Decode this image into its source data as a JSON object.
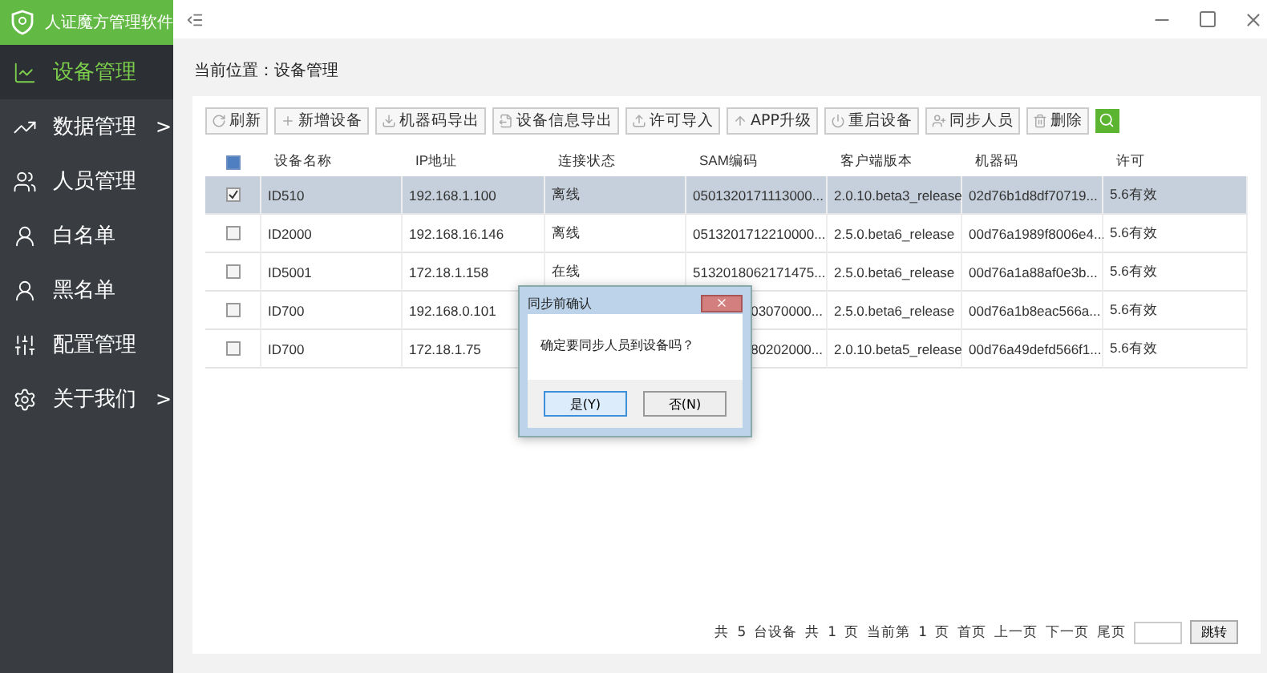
{
  "app": {
    "title": "人证魔方管理软件"
  },
  "sidebar": {
    "items": [
      {
        "label": "设备管理",
        "selected": true
      },
      {
        "label": "数据管理",
        "selected": false,
        "arrow": ">"
      },
      {
        "label": "人员管理",
        "selected": false
      },
      {
        "label": "白名单",
        "selected": false
      },
      {
        "label": "黑名单",
        "selected": false
      },
      {
        "label": "配置管理",
        "selected": false
      },
      {
        "label": "关于我们",
        "selected": false,
        "arrow": ">"
      }
    ]
  },
  "breadcrumb": "当前位置：设备管理",
  "toolbar": {
    "buttons": [
      "刷新",
      "新增设备",
      "机器码导出",
      "设备信息导出",
      "许可导入",
      "APP升级",
      "重启设备",
      "同步人员",
      "删除"
    ]
  },
  "table": {
    "columns": [
      "设备名称",
      "IP地址",
      "连接状态",
      "SAM编码",
      "客户端版本",
      "机器码",
      "许可"
    ],
    "all_checked": false,
    "rows": [
      {
        "selected": true,
        "checked": true,
        "cells": [
          "ID510",
          "192.168.1.100",
          "离线",
          "0501320171113000...",
          "2.0.10.beta3_release",
          "02d76b1d8df70719...",
          "5.6有效"
        ]
      },
      {
        "selected": false,
        "checked": false,
        "cells": [
          "ID2000",
          "192.168.16.146",
          "离线",
          "0513201712210000...",
          "2.5.0.beta6_release",
          "00d76a1989f8006e4...",
          "5.6有效"
        ]
      },
      {
        "selected": false,
        "checked": false,
        "cells": [
          "ID5001",
          "172.18.1.158",
          "在线",
          "5132018062171475...",
          "2.5.0.beta6_release",
          "00d76a1a88af0e3b...",
          "5.6有效"
        ]
      },
      {
        "selected": false,
        "checked": false,
        "covered": true,
        "cells": [
          "ID700",
          "192.168.0.101",
          "",
          "03070000...",
          "2.5.0.beta6_release",
          "00d76a1b8eac566a...",
          "5.6有效"
        ]
      },
      {
        "selected": false,
        "checked": false,
        "covered": true,
        "cells": [
          "ID700",
          "172.18.1.75",
          "",
          "80202000...",
          "2.0.10.beta5_release",
          "00d76a49defd566f1...",
          "5.6有效"
        ]
      }
    ]
  },
  "pagination": {
    "parts": [
      "共",
      "5",
      "台设备",
      "共",
      "1",
      "页",
      "当前第",
      "1",
      "页"
    ],
    "links": [
      "首页",
      "上一页",
      "下一页",
      "尾页"
    ],
    "go_button": "跳转"
  },
  "dialog": {
    "title": "同步前确认",
    "message": "确定要同步人员到设备吗？",
    "buttons": [
      {
        "label": "是(Y)",
        "selected": true
      },
      {
        "label": "否(N)",
        "selected": false
      }
    ]
  }
}
